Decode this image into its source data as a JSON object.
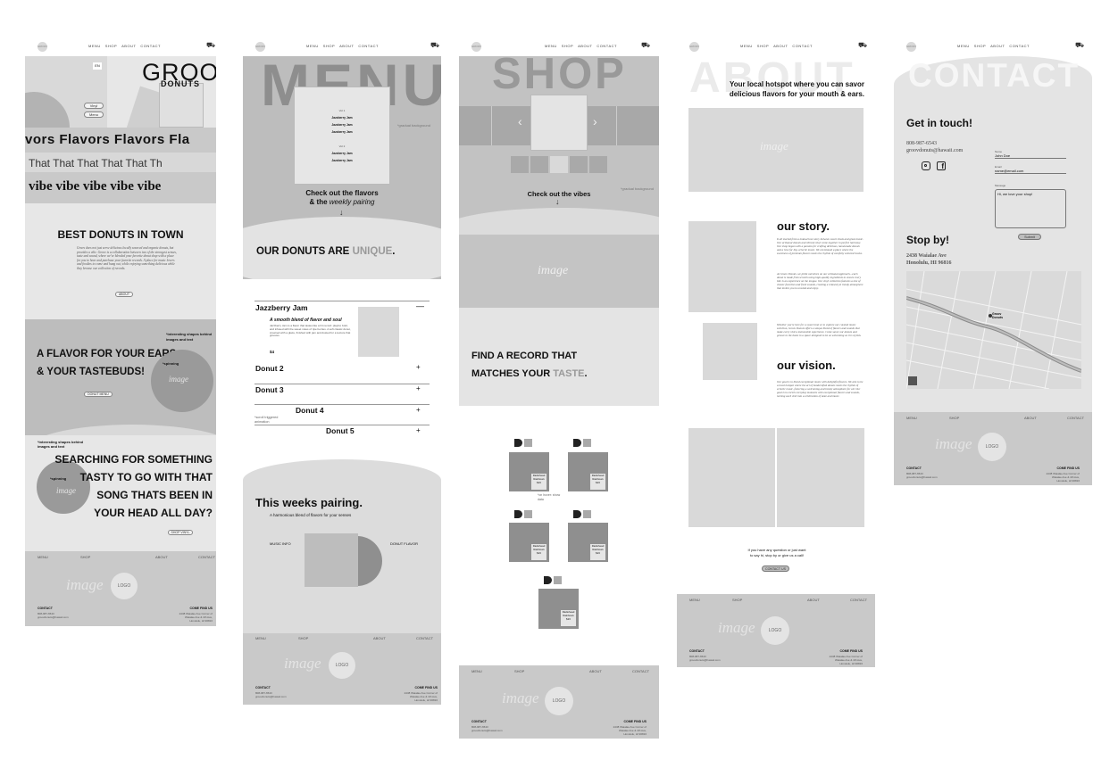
{
  "nav": {
    "logo": "GROOV",
    "links": [
      "MENU",
      "SHOP",
      "ABOUT",
      "CONTACT"
    ],
    "cart": "cart-icon"
  },
  "home": {
    "brand_top": "GROOV",
    "brand_bottom": "DONUTS",
    "lang": "EN",
    "vinyl_label": "Vinyl",
    "menu_label": "Menu",
    "marquee1": "vors  Flavors  Flavors  Fla",
    "marquee2": "That   That   That   That   That   Th",
    "marquee3": "vibe  vibe  vibe  vibe  vibe",
    "best_title": "BEST DONUTS IN TOWN",
    "best_body": "Groov does not just serve delicious locally sourced and organic donuts, but provides a vibe. Groov is a collaboration between two of the strongest senses, taste and sound, where we've blended your favorite donut shop with a place for you to hear and purchase your favorite records. A place for music lovers and foodies to come and hang out, while enjoying something delicious while they browse our collection of records.",
    "about_btn": "ABOUT",
    "flavor_note": "*interesting shapes behind images and text",
    "flavor_title1": "A FLAVOR FOR YOUR EARS",
    "flavor_title2": "& YOUR TASTEBUDS!",
    "spinning": "*spinning",
    "image": "image",
    "donut_menu_btn": "DONUT MENU",
    "search_note": "*interesting shapes behind images and text",
    "search_l1": "SEARCHING FOR SOMETHING",
    "search_l2": "TASTY TO GO WITH THAT",
    "search_l3": "SONG THATS BEEN IN",
    "search_l4": "YOUR HEAD ALL DAY?",
    "shop_btn": "SHOP VINYL"
  },
  "footer": {
    "links": [
      "MENU",
      "SHOP",
      "ABOUT",
      "CONTACT"
    ],
    "image": "image",
    "logo": "LOGO",
    "contact_h": "CONTACT",
    "contact_1": "808-987-6543",
    "contact_2": "groovdonuts@hawaii.com",
    "come_h": "COME FIND US",
    "come_1": "2438 Waialae Ave Corner of",
    "come_2": "Waialae Ave & 4th Ave,",
    "come_3": "Honolulu, HI 96816"
  },
  "menu": {
    "hero": "MENU",
    "card_vol1": "Vol 1",
    "card_vol2": "Vol 2",
    "card_items": [
      "Jazzberry Jam",
      "Jazzberry Jam",
      "Jazzberry Jam"
    ],
    "scroll_note": "*gradual background",
    "check1": "Check out the flavors",
    "check2": "& the ",
    "check2b": "weekly pairing",
    "unique_a": "OUR DONUTS ARE ",
    "unique_b": "UNIQUE",
    "item1": "Jazzberry Jam",
    "item1_sub": "A smooth blend of flavor and soul",
    "item1_body": "Jazzberry Jam is a flavor that tastes like a hit record: playful, bold, and infused with the sweet notes of ripe berries. A soft classic donut, crowned with a glaze, finished with jam and dusted for a texture that grooves.",
    "item1_price": "$4",
    "minus": "—",
    "items": [
      "Donut 2",
      "Donut 3",
      "Donut 4",
      "Donut 5"
    ],
    "plus": "+",
    "scroll_trig": "*scroll triggered animation",
    "pairing_title": "This weeks pairing.",
    "pairing_sub": "A harmonious blend of flavors for your senses",
    "music_info": "MUSIC INFO",
    "donut_flavor": "DONUT FLAVOR"
  },
  "shop": {
    "hero": "SHOP",
    "prev": "‹",
    "next": "›",
    "check": "Check out the vibes",
    "note": "*gradual background",
    "image": "image",
    "find1": "FIND A RECORD THAT",
    "find2a": "MATCHES YOUR ",
    "find2b": "TASTE",
    "record_title": "Radiohead",
    "record_sub": "Rainbows",
    "record_price": "$23",
    "hover_note": "*on hover: show data"
  },
  "about": {
    "hero": "ABOUT",
    "tagline1": "Your local hotspot where you can savor",
    "tagline2": "delicious flavors for your mouth & ears.",
    "image": "image",
    "story_h": "our story.",
    "story_p1": "It all started from a mutual love story between sweet treats and great music. Our artisanal donuts and vibrant vinyl come together in perfect harmony. Our shop began with a passion for crafting delicious, hand-made donuts and a love for hip, eclectic music. We envisioned a place where the sweetness of premium flavors meets the rhythm of carefully selected tracks.",
    "story_p2": "At Groov Donuts, we pride ourselves on our artisanal approach—each donut is made from scratch using high-quality ingredients to ensure every bite is an experience on the tongue. Our vinyl collection features a mix of classic favorites and fresh sounds, creating a relaxed yet trendy atmosphere that invites you to unwind and enjoy.",
    "story_p3": "Whether you're here for a sweet treat or to explore our curated music selection, Groov Donuts offers a unique blend of flavors and sounds that make every visit a memorable experience. Come savor our donuts and groove to the beats in a space designed to be as welcoming as it is stylish.",
    "vision_h": "our vision.",
    "vision_p": "Our goal is to blend exceptional music with delightful flavors. We aim to be a local hotspot where the art of handcrafted donuts meets the rhythm of eclectic music, fostering a welcoming and trendy atmosphere for all. Our goal is to enrich everyday moments with exceptional flavors and sounds, turning each visit into a celebration of taste and music.",
    "q1": "If you have any question or just want",
    "q2": "to say hi, stop by or give us a call!",
    "contact_btn": "CONTACT US"
  },
  "contact": {
    "hero": "CONTACT",
    "get": "Get in touch!",
    "phone": "808-987-6543",
    "email": "groovdonuts@hawaii.com",
    "insta": "instagram-icon",
    "fb": "facebook-icon",
    "name_lbl": "Name",
    "name_val": "John Doe",
    "email_lbl": "Email",
    "email_val": "name@email.com",
    "msg_lbl": "Message",
    "msg_val": "Hi, we love your shop!",
    "submit": "Submit",
    "stop": "Stop by!",
    "addr1": "2438 Waialae Ave",
    "addr2": "Honolulu, HI 96816",
    "map_label1": "Groov",
    "map_label2": "Donuts"
  }
}
